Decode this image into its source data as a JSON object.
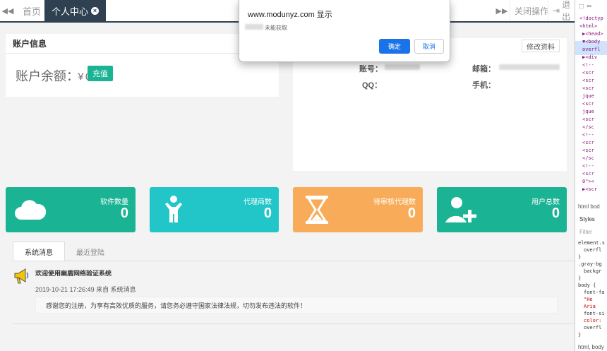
{
  "tabbar": {
    "tabs": [
      {
        "label": "首页"
      },
      {
        "label": "个人中心",
        "active": true
      }
    ],
    "close_ops": "关闭操作",
    "logout": "退出"
  },
  "account_panel": {
    "title": "账户信息",
    "balance_label": "账户余额：",
    "balance_value": "￥0",
    "recharge": "充值"
  },
  "profile_panel": {
    "edit": "修改资料",
    "fields": [
      {
        "label": "账号："
      },
      {
        "label": "邮箱："
      },
      {
        "label": "QQ："
      },
      {
        "label": "手机："
      }
    ]
  },
  "stats": [
    {
      "title": "软件数量",
      "value": "0",
      "color": "#1ab394",
      "icon": "cloud-icon"
    },
    {
      "title": "代理商数",
      "value": "0",
      "color": "#23c6c8",
      "icon": "person-icon"
    },
    {
      "title": "待审核代理数",
      "value": "0",
      "color": "#f8ac59",
      "icon": "hourglass-icon"
    },
    {
      "title": "用户总数",
      "value": "0",
      "color": "#1ab394",
      "icon": "user-add-icon"
    }
  ],
  "messages": {
    "tabs": [
      "系统消息",
      "最近登陆"
    ],
    "title": "欢迎使用幽盾网络验证系统",
    "meta": "2019-10-21 17:26:49 来自 系统消息",
    "body": "感谢您的注册，为享有高效优质的服务，请您务必遵守国家法律法规，切勿发布违法的软件！"
  },
  "dialog": {
    "title": "www.modunyz.com 显示",
    "message": "未能获取",
    "ok": "确定",
    "cancel": "取消"
  },
  "devtools": {
    "lines": [
      "<!doctyp",
      "<html>",
      "▶<head>",
      "▼<body",
      "overfl",
      "▶<div",
      "<!--",
      "<scr",
      "<scr",
      "<scr",
      "jque",
      "<scr",
      "jque",
      "<scr",
      "</sc",
      "<!--",
      "<scr",
      "<scr",
      "</sc",
      "<!--",
      "<scr",
      "0\"><",
      "▶<scr"
    ],
    "tabs": [
      "html",
      "bod"
    ],
    "styles_tab": "Styles",
    "filter": "Filter",
    "css": [
      "element.s",
      "overfl",
      "}",
      ".gray-bg",
      "backgr",
      "}",
      "body {",
      "font-fa",
      "\"He",
      "Aria",
      "font-si",
      "color:",
      "overfl",
      "}"
    ],
    "breadcrumb": "html, body"
  }
}
